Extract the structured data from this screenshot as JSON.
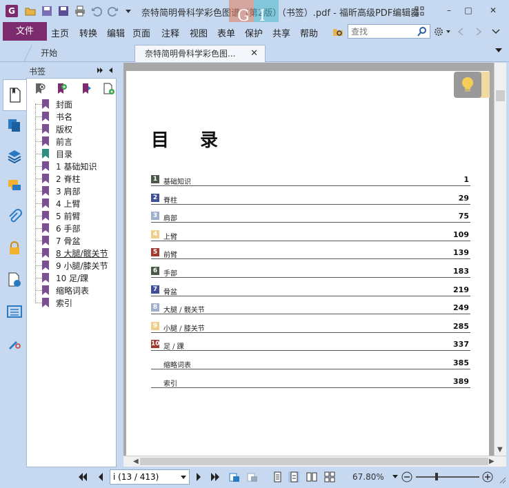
{
  "window": {
    "title": "奈特简明骨科学彩色图谱（第2版）（书签）.pdf - 福昕高级PDF编辑器",
    "minimize": "–",
    "maximize": "□",
    "close": "✕"
  },
  "menu": {
    "file": "文件",
    "items": [
      "主页",
      "转换",
      "编辑",
      "页面",
      "注释",
      "视图",
      "表单",
      "保护",
      "共享",
      "帮助"
    ],
    "search_placeholder": "查找"
  },
  "tabs": {
    "start": "开始",
    "document": "奈特简明骨科学彩色图...",
    "close": "✕"
  },
  "bookmarks": {
    "title": "书签",
    "items": [
      {
        "label": "封面",
        "flag": "#7b4f92"
      },
      {
        "label": "书名",
        "flag": "#7b4f92"
      },
      {
        "label": "版权",
        "flag": "#7b4f92"
      },
      {
        "label": "前言",
        "flag": "#7b4f92"
      },
      {
        "label": "目录",
        "flag": "#2f8f7f"
      },
      {
        "label": "1 基础知识",
        "flag": "#7b4f92"
      },
      {
        "label": "2 脊柱",
        "flag": "#7b4f92"
      },
      {
        "label": "3 肩部",
        "flag": "#7b4f92"
      },
      {
        "label": "4 上臂",
        "flag": "#7b4f92"
      },
      {
        "label": "5 前臂",
        "flag": "#7b4f92"
      },
      {
        "label": "6 手部",
        "flag": "#7b4f92"
      },
      {
        "label": "7 骨盆",
        "flag": "#7b4f92"
      },
      {
        "label": "8 大腿/髋关节",
        "flag": "#7b4f92",
        "selected": true
      },
      {
        "label": "9 小腿/膝关节",
        "flag": "#7b4f92"
      },
      {
        "label": "10 足/踝",
        "flag": "#7b4f92"
      },
      {
        "label": "缩略词表",
        "flag": "#7b4f92"
      },
      {
        "label": "索引",
        "flag": "#7b4f92"
      }
    ]
  },
  "document": {
    "toc_title": "目 录",
    "entries": [
      {
        "num": "1",
        "label": "基础知识",
        "page": "1",
        "color": "#4a5a44"
      },
      {
        "num": "2",
        "label": "脊柱",
        "page": "29",
        "color": "#3f4f9a"
      },
      {
        "num": "3",
        "label": "肩部",
        "page": "75",
        "color": "#9fb0cc"
      },
      {
        "num": "4",
        "label": "上臂",
        "page": "109",
        "color": "#f0cf8a"
      },
      {
        "num": "5",
        "label": "前臂",
        "page": "139",
        "color": "#a33a2f"
      },
      {
        "num": "6",
        "label": "手部",
        "page": "183",
        "color": "#4a5a44"
      },
      {
        "num": "7",
        "label": "骨盆",
        "page": "219",
        "color": "#3f4f9a"
      },
      {
        "num": "8",
        "label": "大腿 / 髋关节",
        "page": "249",
        "color": "#9fb0cc"
      },
      {
        "num": "9",
        "label": "小腿 / 膝关节",
        "page": "285",
        "color": "#f0cf8a"
      },
      {
        "num": "10",
        "label": "足 / 踝",
        "page": "337",
        "color": "#a33a2f"
      },
      {
        "num": "",
        "label": "缩略词表",
        "page": "385",
        "color": ""
      },
      {
        "num": "",
        "label": "索引",
        "page": "389",
        "color": ""
      }
    ]
  },
  "status": {
    "page_value": "i (13 / 413)",
    "zoom": "67.80%"
  }
}
